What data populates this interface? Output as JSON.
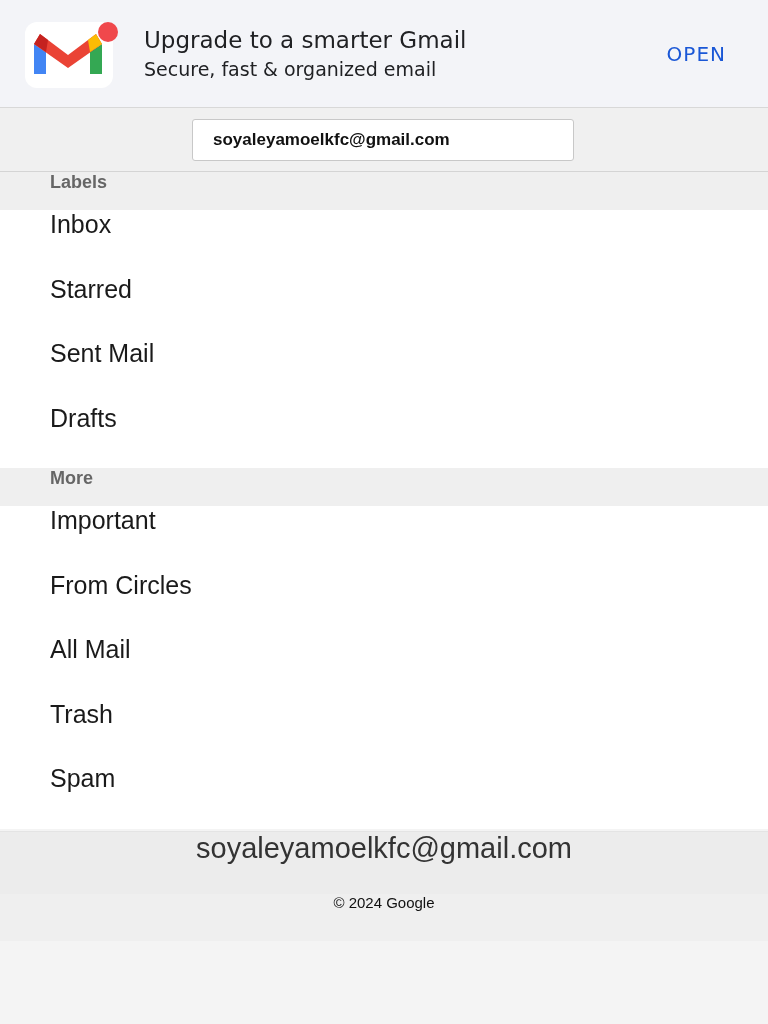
{
  "banner": {
    "title": "Upgrade to a smarter Gmail",
    "subtitle": "Secure, fast & organized email",
    "action": "OPEN"
  },
  "account_selector": {
    "value": "soyaleyamoelkfc@gmail.com"
  },
  "sections": [
    {
      "heading": "Labels",
      "items": [
        "Inbox",
        "Starred",
        "Sent Mail",
        "Drafts"
      ]
    },
    {
      "heading": "More",
      "items": [
        "Important",
        "From Circles",
        "All Mail",
        "Trash",
        "Spam"
      ]
    }
  ],
  "footer": {
    "account": "soyaleyamoelkfc@gmail.com",
    "copyright": "© 2024 Google"
  }
}
